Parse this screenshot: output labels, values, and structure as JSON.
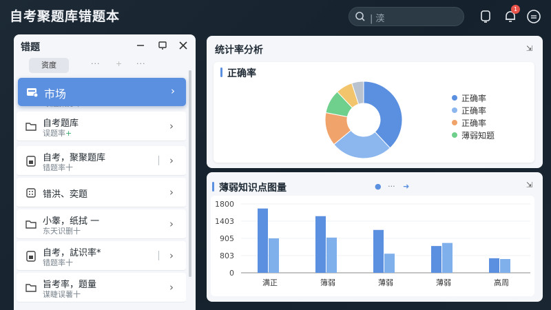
{
  "app": {
    "title": "自考聚题库错题本"
  },
  "search": {
    "placeholder": "| 湙"
  },
  "left_panel": {
    "title": "错题",
    "tabs": {
      "active": "资度",
      "dots1": "···",
      "dots2": "···"
    },
    "market": {
      "label": "市场",
      "sub": "以题集分市"
    },
    "items": [
      {
        "title": "自考题库",
        "sub": "误题率",
        "plus": "+",
        "icon": "folder-icon"
      },
      {
        "title": "自考，聚聚题库",
        "sub": "错题率十",
        "icon": "document-icon"
      },
      {
        "title": "错洪、奕题",
        "sub": "",
        "icon": "grid-icon"
      },
      {
        "title": "小睾，纸拭 一",
        "sub": "东天识删十",
        "icon": "folder-icon"
      },
      {
        "title": "自考，訧识率*",
        "sub": "错题率十",
        "icon": "document-icon"
      },
      {
        "title": "旨考率，题量",
        "sub": "谋睫误薯十",
        "icon": "folder-icon"
      }
    ]
  },
  "stats_panel": {
    "title": "统计率分析",
    "subtitle": "正确率",
    "legend": [
      "正确率",
      "正确率",
      "正确率",
      "薄弱知题"
    ]
  },
  "weak_panel": {
    "title": "薄弱知识点图量",
    "ctrl_dots": "···"
  },
  "chart_data": [
    {
      "type": "pie",
      "title": "正确率",
      "slices": [
        {
          "label": "正确率",
          "value": 38,
          "color": "#5b8fe0"
        },
        {
          "label": "正确率",
          "value": 26,
          "color": "#8bb6ee"
        },
        {
          "label": "正确率",
          "value": 14,
          "color": "#f0a36a"
        },
        {
          "label": "薄弱知题",
          "value": 10,
          "color": "#6fcf8c"
        },
        {
          "label": "",
          "value": 7,
          "color": "#f2c46b"
        },
        {
          "label": "",
          "value": 5,
          "color": "#b9c3cf"
        }
      ]
    },
    {
      "type": "bar",
      "title": "薄弱知识点图量",
      "categories": [
        "满正",
        "簿弱",
        "薄弱",
        "薄弱",
        "高周"
      ],
      "series": [
        {
          "values": [
            1680,
            1480,
            1120,
            700,
            380
          ],
          "color": "#5b8fe0"
        },
        {
          "values": [
            900,
            920,
            500,
            780,
            360
          ],
          "color": "#7fb0ec"
        }
      ],
      "yticks": [
        "1800",
        "1403",
        "905",
        "803",
        "0"
      ],
      "ylim": [
        0,
        1800
      ]
    }
  ]
}
